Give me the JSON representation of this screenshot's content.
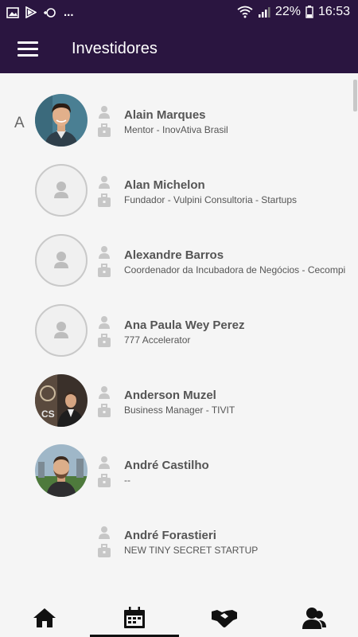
{
  "status": {
    "notifications": [
      "image-icon",
      "play-store-icon",
      "data-saver-icon"
    ],
    "more": "...",
    "battery": "22%",
    "time": "16:53"
  },
  "header": {
    "title": "Investidores"
  },
  "section_letter": "A",
  "investors": [
    {
      "name": "Alain Marques",
      "role": "Mentor - InovAtiva Brasil",
      "avatar": "photo"
    },
    {
      "name": "Alan Michelon",
      "role": "Fundador - Vulpini Consultoria - Startups",
      "avatar": "placeholder"
    },
    {
      "name": "Alexandre Barros",
      "role": "Coordenador da Incubadora de Negócios - Cecompi",
      "avatar": "placeholder"
    },
    {
      "name": "Ana Paula Wey Perez",
      "role": "777 Accelerator",
      "avatar": "placeholder"
    },
    {
      "name": "Anderson Muzel",
      "role": "Business Manager - TIVIT",
      "avatar": "photo"
    },
    {
      "name": "André Castilho",
      "role": "--",
      "avatar": "photo"
    },
    {
      "name": "André Forastieri",
      "role": "NEW TINY SECRET STARTUP",
      "avatar": "none"
    }
  ],
  "nav": [
    "home-icon",
    "calendar-icon",
    "handshake-icon",
    "people-icon"
  ],
  "active_nav": "calendar-icon",
  "colors": {
    "primary": "#2a1540",
    "text": "#555555",
    "placeholder": "#c9c9c9"
  }
}
